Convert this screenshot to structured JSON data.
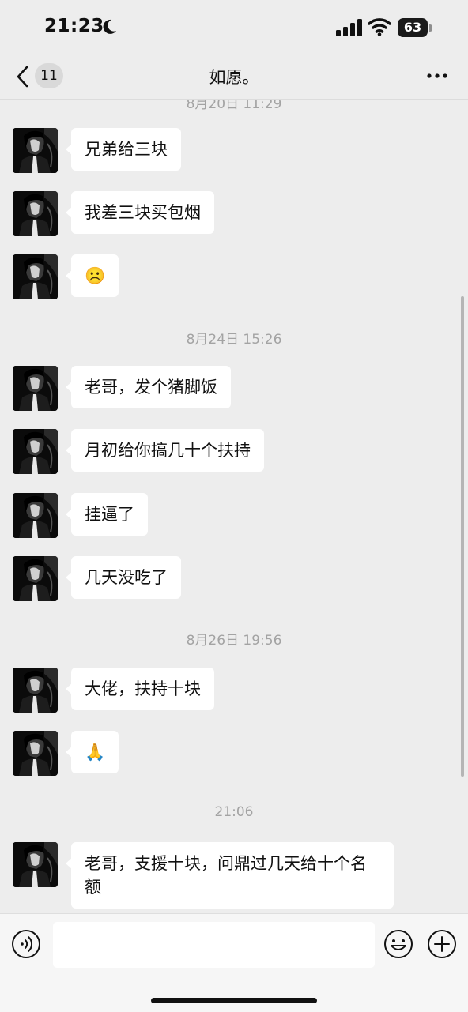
{
  "status_bar": {
    "time": "21:23",
    "battery_level": "63"
  },
  "nav": {
    "unread_count": "11",
    "title": "如愿。"
  },
  "timestamps": [
    "8月20日 11:29",
    "8月24日 15:26",
    "8月26日 19:56",
    "21:06"
  ],
  "messages": [
    {
      "text": "兄弟给三块"
    },
    {
      "text": "我差三块买包烟"
    },
    {
      "text": "☹️"
    },
    {
      "text": " 老哥，发个猪脚饭"
    },
    {
      "text": "月初给你搞几十个扶持"
    },
    {
      "text": "挂逼了"
    },
    {
      "text": "几天没吃了"
    },
    {
      "text": "大佬，扶持十块"
    },
    {
      "text": "🙏"
    },
    {
      "text": "老哥，支援十块，问鼎过几天给十个名额"
    }
  ],
  "input": {
    "placeholder": ""
  },
  "icons": {
    "back": "chevron-left-icon",
    "more": "more-dots-icon",
    "voice": "voice-icon",
    "emoji": "emoji-icon",
    "plus": "plus-icon"
  }
}
